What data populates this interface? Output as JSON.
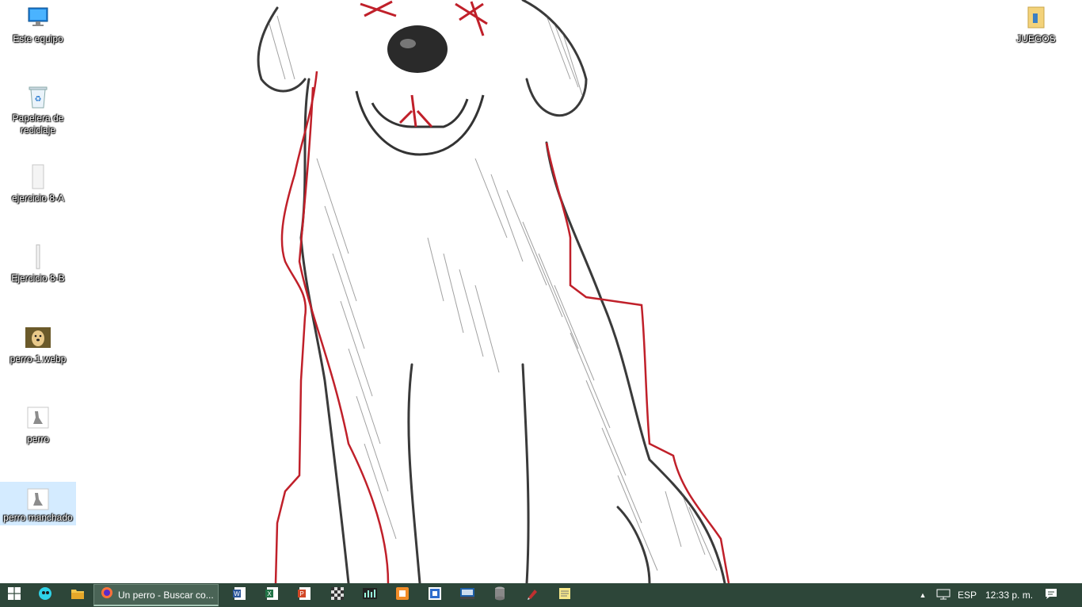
{
  "desktop": {
    "icons": [
      {
        "label": "Este equipo",
        "icon": "computer-icon"
      },
      {
        "label": "Papelera de reciclaje",
        "icon": "recycle-bin-icon"
      },
      {
        "label": "ejercicio 8-A",
        "icon": "document-icon"
      },
      {
        "label": "Ejercicio 8-B",
        "icon": "document-icon"
      },
      {
        "label": "perro-1.webp",
        "icon": "image-thumbnail-icon"
      },
      {
        "label": "perro",
        "icon": "image-file-icon"
      },
      {
        "label": "perro manchado",
        "icon": "image-file-icon"
      },
      {
        "label": "JUEGOS",
        "icon": "folder-icon"
      }
    ],
    "wallpaper": "dog-sketch-drawing"
  },
  "taskbar": {
    "start_icon": "windows-start-icon",
    "firefox_label": "Un perro - Buscar co...",
    "pinned": [
      "cortana-icon",
      "file-explorer-icon",
      "word-icon",
      "excel-icon",
      "powerpoint-icon",
      "chess-app-icon",
      "audio-app-icon",
      "orange-app-icon",
      "blue-app-icon",
      "video-app-icon",
      "database-app-icon",
      "pen-app-icon",
      "notes-app-icon"
    ],
    "tray": {
      "language": "ESP",
      "time": "12:33 p. m."
    },
    "colors": {
      "background": "#2d4639"
    }
  }
}
